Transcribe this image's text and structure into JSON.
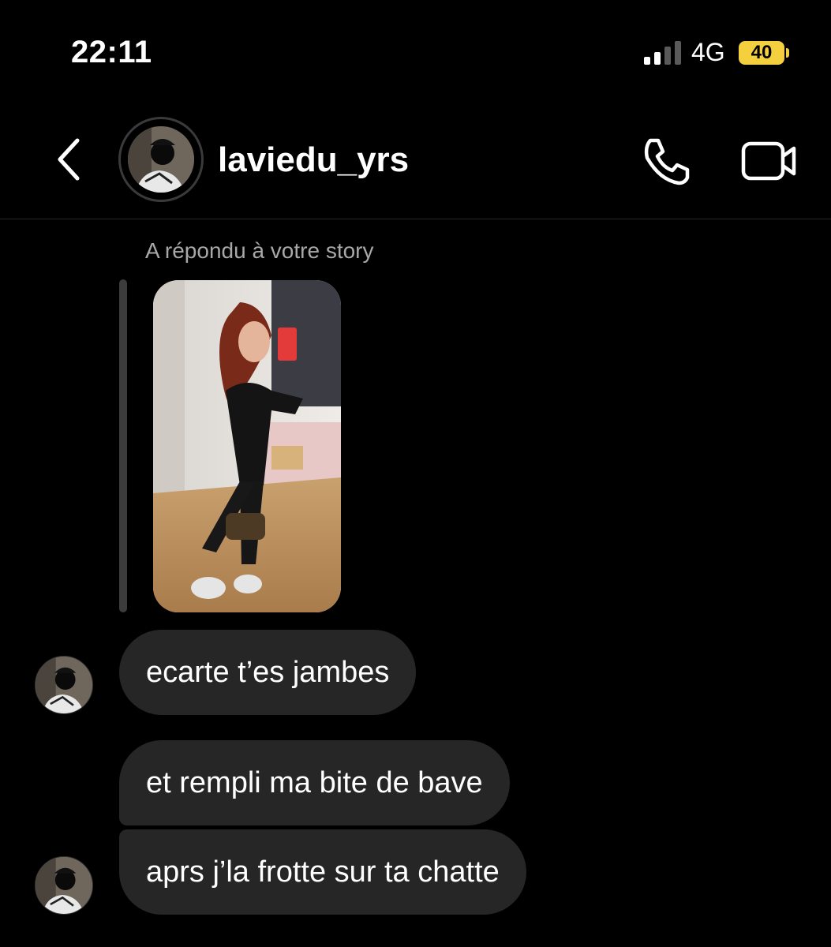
{
  "status_bar": {
    "time": "22:11",
    "network": "4G",
    "battery": "40",
    "battery_color": "#f4d03f"
  },
  "header": {
    "back_icon": "chevron-left-icon",
    "username": "laviedu_yrs",
    "call_icon": "phone-icon",
    "video_icon": "video-camera-icon"
  },
  "conversation": {
    "story_reply_label": "A répondu à votre story",
    "messages": [
      {
        "text": "ecarte t’es jambes"
      },
      {
        "text": "et rempli ma bite de bave"
      },
      {
        "text": "aprs j’la frotte sur ta chatte"
      }
    ]
  },
  "colors": {
    "background": "#000000",
    "bubble": "#262626",
    "secondary_text": "#a8a8a8"
  }
}
